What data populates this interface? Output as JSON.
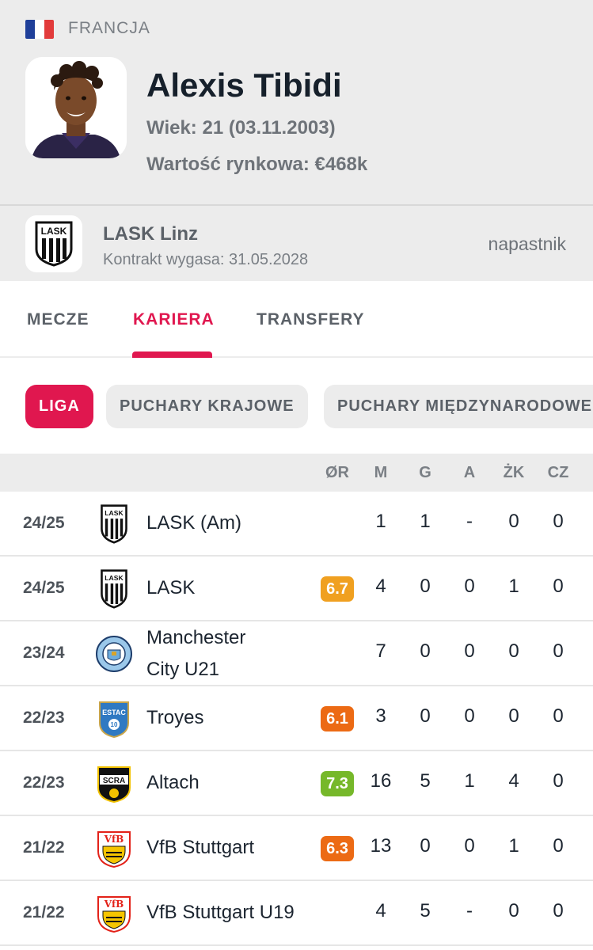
{
  "profile": {
    "country": "FRANCJA",
    "flag_colors": [
      "#1f3f99",
      "#ffffff",
      "#e23b3b"
    ],
    "name": "Alexis Tibidi",
    "age": "Wiek: 21 (03.11.2003)",
    "market_value": "Wartość rynkowa: €468k"
  },
  "club": {
    "logo_text": "LASK",
    "name": "LASK Linz",
    "contract": "Kontrakt wygasa: 31.05.2028",
    "position": "napastnik"
  },
  "tabs": [
    {
      "label": "MECZE"
    },
    {
      "label": "KARIERA"
    },
    {
      "label": "TRANSFERY"
    }
  ],
  "filters": [
    {
      "label": "LIGA"
    },
    {
      "label": "PUCHARY KRAJOWE"
    },
    {
      "label": "PUCHARY MIĘDZYNARODOWE"
    }
  ],
  "accent_color": "#e0174f",
  "table": {
    "headers": [
      "ØR",
      "M",
      "G",
      "A",
      "ŻK",
      "CZ"
    ],
    "rows": [
      {
        "season": "24/25",
        "team": "LASK (Am)",
        "logo": "lask",
        "rating": "",
        "m": "1",
        "g": "1",
        "a": "-",
        "zk": "0",
        "cz": "0"
      },
      {
        "season": "24/25",
        "team": "LASK",
        "logo": "lask",
        "rating": "6.7",
        "rating_color": "#f0a020",
        "m": "4",
        "g": "0",
        "a": "0",
        "zk": "1",
        "cz": "0"
      },
      {
        "season": "23/24",
        "team": "Manchester City U21",
        "team_line1": "Manchester",
        "team_line2": "City U21",
        "logo": "mancity",
        "rating": "",
        "m": "7",
        "g": "0",
        "a": "0",
        "zk": "0",
        "cz": "0"
      },
      {
        "season": "22/23",
        "team": "Troyes",
        "logo": "troyes",
        "rating": "6.1",
        "rating_color": "#ec6a14",
        "m": "3",
        "g": "0",
        "a": "0",
        "zk": "0",
        "cz": "0"
      },
      {
        "season": "22/23",
        "team": "Altach",
        "logo": "altach",
        "rating": "7.3",
        "rating_color": "#76b82a",
        "m": "16",
        "g": "5",
        "a": "1",
        "zk": "4",
        "cz": "0"
      },
      {
        "season": "21/22",
        "team": "VfB Stuttgart",
        "logo": "stuttgart",
        "rating": "6.3",
        "rating_color": "#ec6a14",
        "m": "13",
        "g": "0",
        "a": "0",
        "zk": "1",
        "cz": "0"
      },
      {
        "season": "21/22",
        "team": "VfB Stuttgart U19",
        "logo": "stuttgart",
        "rating": "",
        "m": "4",
        "g": "5",
        "a": "-",
        "zk": "0",
        "cz": "0"
      }
    ]
  }
}
